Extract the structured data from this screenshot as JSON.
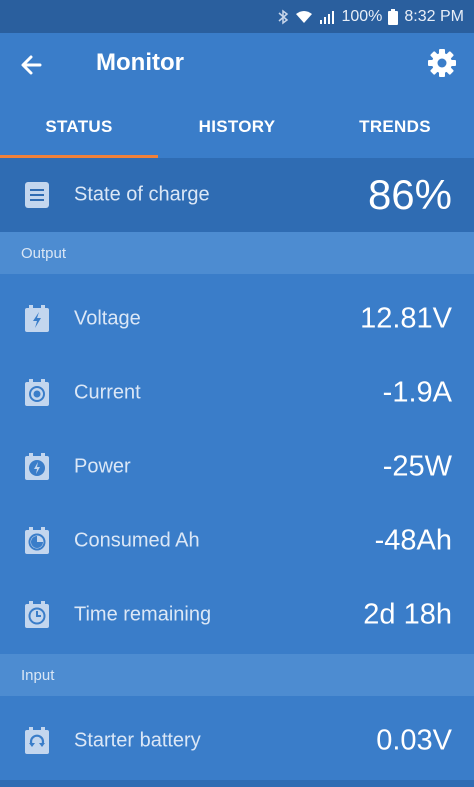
{
  "status_bar": {
    "battery": "100%",
    "time": "8:32 PM"
  },
  "appbar": {
    "title": "Monitor"
  },
  "tabs": [
    {
      "label": "STATUS",
      "active": true
    },
    {
      "label": "HISTORY",
      "active": false
    },
    {
      "label": "TRENDS",
      "active": false
    }
  ],
  "soc": {
    "label": "State of charge",
    "value": "86%"
  },
  "sections": {
    "output": "Output",
    "input": "Input"
  },
  "output_rows": [
    {
      "label": "Voltage",
      "value": "12.81V",
      "icon": "bolt-battery-icon"
    },
    {
      "label": "Current",
      "value": "-1.9A",
      "icon": "circle-battery-icon"
    },
    {
      "label": "Power",
      "value": "-25W",
      "icon": "power-battery-icon"
    },
    {
      "label": "Consumed Ah",
      "value": "-48Ah",
      "icon": "consumed-battery-icon"
    },
    {
      "label": "Time remaining",
      "value": "2d 18h",
      "icon": "clock-battery-icon"
    }
  ],
  "input_rows": [
    {
      "label": "Starter battery",
      "value": "0.03V",
      "icon": "refresh-battery-icon"
    }
  ],
  "colors": {
    "primary": "#3a7dc9",
    "dark": "#2a5f9e",
    "section": "#4d8cd1",
    "accent": "#f0813a"
  }
}
